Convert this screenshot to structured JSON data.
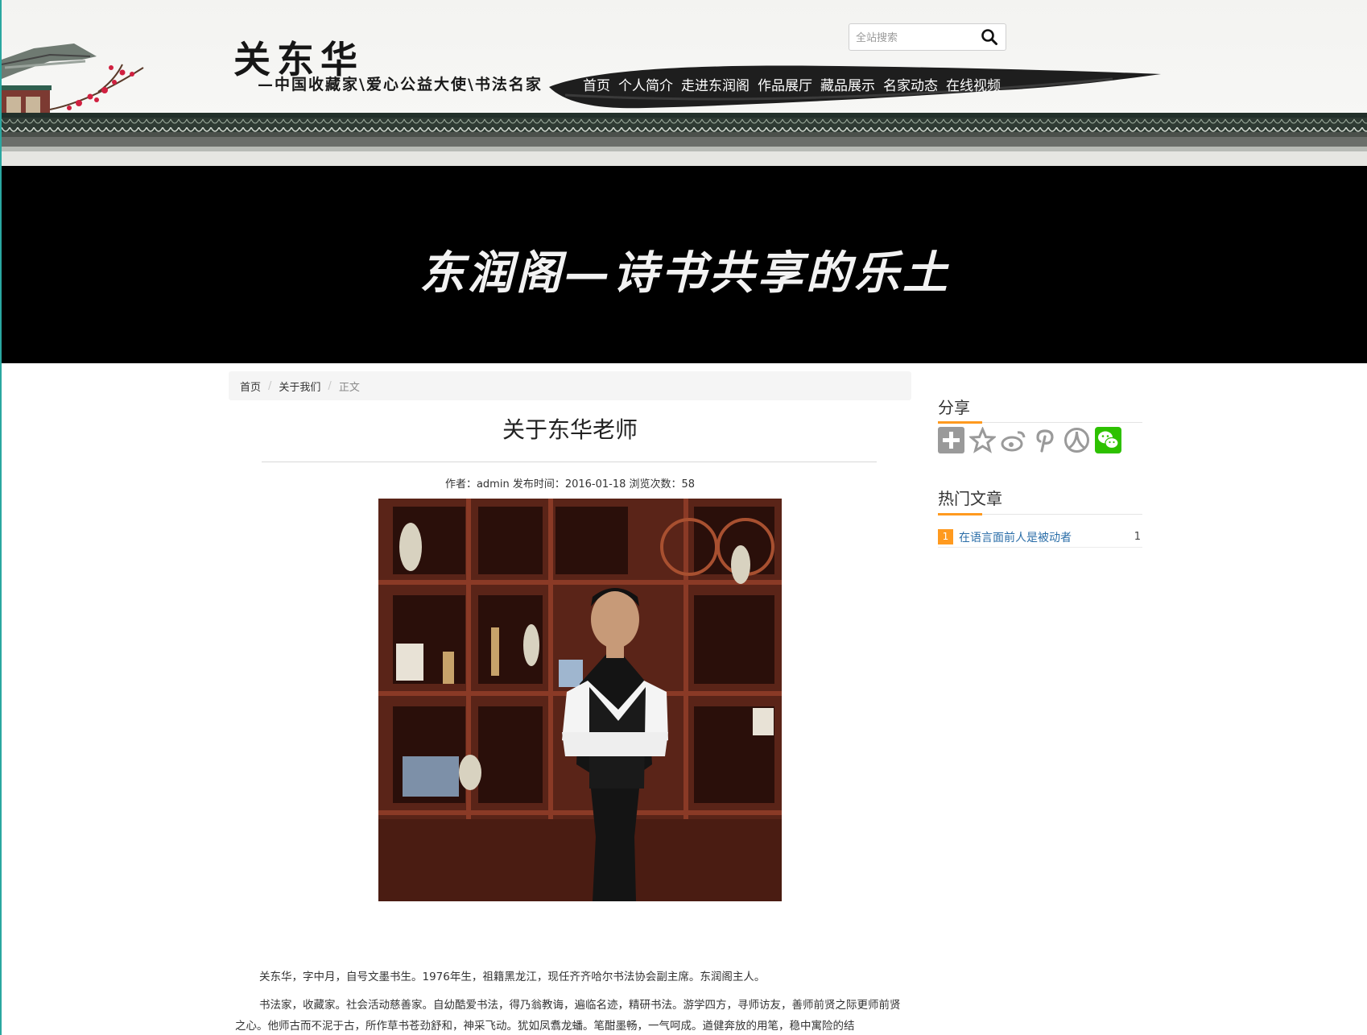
{
  "header": {
    "site_title": "关东华",
    "site_tagline": "—中国收藏家\\爱心公益大使\\书法名家",
    "search": {
      "placeholder": "全站搜索",
      "icon": "search-icon"
    },
    "nav": [
      {
        "label": "首页"
      },
      {
        "label": "个人简介"
      },
      {
        "label": "走进东润阁"
      },
      {
        "label": "作品展厅"
      },
      {
        "label": "藏品展示"
      },
      {
        "label": "名家动态"
      },
      {
        "label": "在线视频"
      }
    ]
  },
  "banner": {
    "slogan": "东润阁—诗书共享的乐土"
  },
  "breadcrumb": [
    {
      "label": "首页"
    },
    {
      "label": "关于我们"
    },
    {
      "label": "正文"
    }
  ],
  "article": {
    "title": "关于东华老师",
    "meta": "作者：admin 发布时间：2016-01-18 浏览次数：58",
    "paragraphs": [
      "关东华，字中月，自号文墨书生。1976年生，祖籍黑龙江，现任齐齐哈尔书法协会副主席。东润阁主人。",
      "书法家，收藏家。社会活动慈善家。自幼酷爱书法，得乃翁教诲，遍临名迹，精研书法。游学四方，寻师访友，善师前贤之际更师前贤之心。他师古而不泥于古，所作草书苍劲舒和，神采飞动。犹如凤翥龙蟠。笔酣墨畅，一气呵成。遒健奔放的用笔，稳中寓险的结"
    ]
  },
  "sidebar": {
    "share": {
      "heading": "分享",
      "icons": [
        "plus-icon",
        "star-icon",
        "weibo-icon",
        "pinterest-icon",
        "renren-icon",
        "wechat-icon"
      ]
    },
    "hot": {
      "heading": "热门文章",
      "items": [
        {
          "rank": "1",
          "title": "在语言面前人是被动者",
          "count": "1"
        }
      ]
    }
  },
  "colors": {
    "accent": "#ff9a1f",
    "link": "#2b6ea8",
    "banner_bg": "#000000",
    "wechat_green": "#2dc100"
  }
}
